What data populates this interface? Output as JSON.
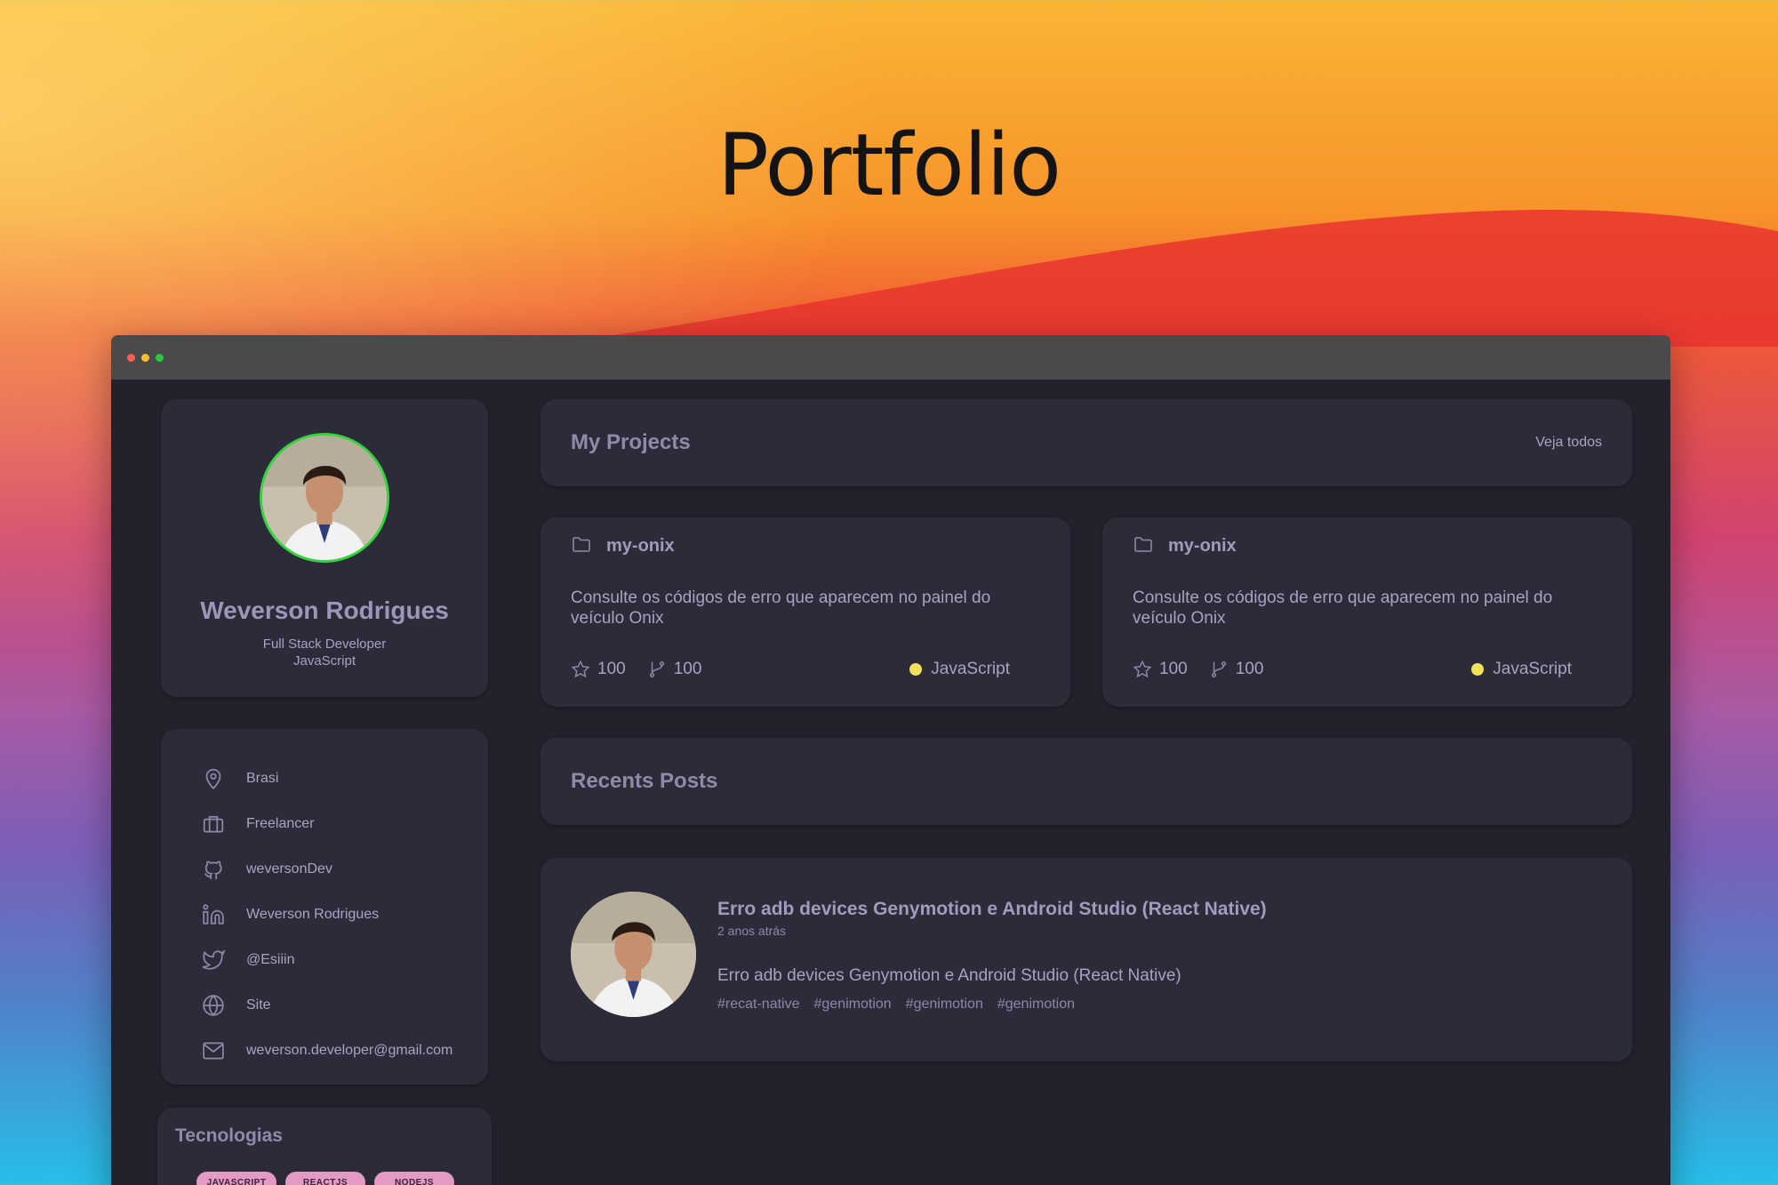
{
  "hero": {
    "title": "Portfolio"
  },
  "colors": {
    "avatar_border": "#35d43e",
    "tag_bg": "#e39ac3",
    "javascript_dot": "#f1e05a"
  },
  "profile": {
    "name": "Weverson Rodrigues",
    "role_line1": "Full Stack Developer",
    "role_line2": "JavaScript"
  },
  "info": [
    {
      "icon": "location-pin-icon",
      "label": "Brasi"
    },
    {
      "icon": "briefcase-icon",
      "label": "Freelancer"
    },
    {
      "icon": "github-icon",
      "label": "weversonDev"
    },
    {
      "icon": "linkedin-icon",
      "label": "Weverson Rodrigues"
    },
    {
      "icon": "twitter-icon",
      "label": "@Esiiin"
    },
    {
      "icon": "globe-icon",
      "label": "Site"
    },
    {
      "icon": "mail-icon",
      "label": "weverson.developer@gmail.com"
    }
  ],
  "technologies": {
    "title": "Tecnologias",
    "tags": [
      "JAVASCRIPT",
      "REACTJS",
      "NODEJS"
    ]
  },
  "projects": {
    "title": "My Projects",
    "see_all": "Veja todos",
    "items": [
      {
        "name": "my-onix",
        "description": "Consulte os códigos de erro que aparecem no painel do veículo Onix",
        "stars": "100",
        "forks": "100",
        "language": "JavaScript"
      },
      {
        "name": "my-onix",
        "description": "Consulte os códigos de erro que aparecem no painel do veículo Onix",
        "stars": "100",
        "forks": "100",
        "language": "JavaScript"
      }
    ]
  },
  "posts": {
    "title": "Recents Posts",
    "items": [
      {
        "title": "Erro adb devices Genymotion e Android Studio (React Native)",
        "time": "2 anos atrás",
        "description": "Erro adb devices Genymotion e Android Studio (React Native)",
        "tags": [
          "#recat-native",
          "#genimotion",
          "#genimotion",
          "#genimotion"
        ]
      }
    ]
  }
}
